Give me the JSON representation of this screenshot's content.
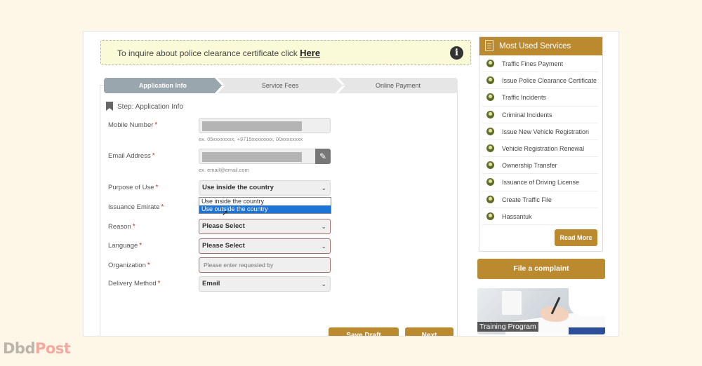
{
  "notice": {
    "text": "To inquire about police clearance certificate click",
    "link": "Here",
    "icon": "info-icon"
  },
  "steps": [
    {
      "label": "Application Info",
      "active": true
    },
    {
      "label": "Service Fees",
      "active": false
    },
    {
      "label": "Online Payment",
      "active": false
    }
  ],
  "step_title": "Step: Application Info",
  "form": {
    "mobile": {
      "label": "Mobile Number",
      "hint": "ex. 05xxxxxxxx, +9715xxxxxxxx, 00xxxxxxxx"
    },
    "email": {
      "label": "Email Address",
      "hint": "ex. email@email.com"
    },
    "purpose": {
      "label": "Purpose of Use",
      "value": "Use inside the country",
      "options": [
        "Use inside the country",
        "Use outside the country"
      ],
      "highlighted": "Use outside the country"
    },
    "emirate": {
      "label": "Issuance Emirate"
    },
    "reason": {
      "label": "Reason",
      "value": "Please Select"
    },
    "language": {
      "label": "Language",
      "value": "Please Select"
    },
    "organization": {
      "label": "Organization",
      "placeholder": "Please enter requested by"
    },
    "delivery": {
      "label": "Delivery Method",
      "value": "Email"
    },
    "required_mark": "*",
    "chevron": "⌄"
  },
  "buttons": {
    "save_draft": "Save Draft",
    "next": "Next"
  },
  "sidebar": {
    "title": "Most Used Services",
    "items": [
      "Traffic Fines Payment",
      "Issue Police Clearance Certificate",
      "Traffic Incidents",
      "Criminal Incidents",
      "Issue New Vehicle Registration",
      "Vehicle Registration Renewal",
      "Ownership Transfer",
      "Issuance of Driving License",
      "Create Traffic File",
      "Hassantuk"
    ],
    "read_more": "Read More",
    "complaint": "File a complaint",
    "training": "Training Program"
  },
  "watermark": {
    "part1": "Dbd",
    "part2": "Post"
  },
  "colors": {
    "gold": "#bb8a2e",
    "step_active": "#9aa6ad",
    "highlight": "#1e74d6",
    "required": "#c0392b"
  }
}
